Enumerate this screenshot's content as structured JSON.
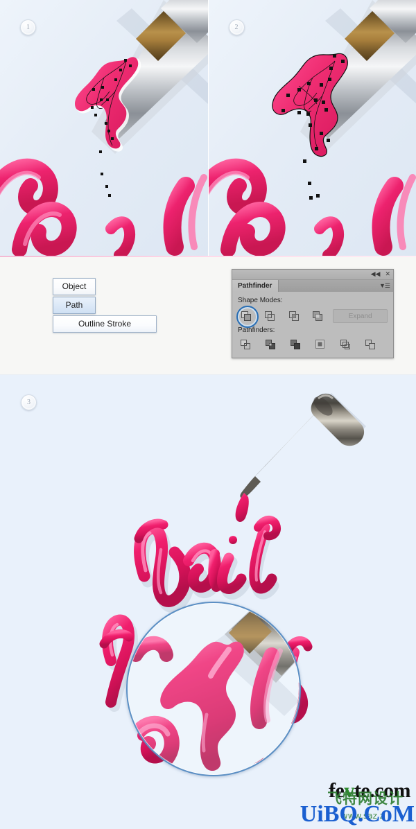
{
  "steps": [
    {
      "number": "1",
      "caption_alt": "Vector path with anchor points drawn over pink polish stroke"
    },
    {
      "number": "2",
      "caption_alt": "Stroke converted to outlined filled shape with black outline"
    },
    {
      "number": "3",
      "caption_alt": "Final Nail Polish lettering with magnifier detail"
    }
  ],
  "menu": {
    "items": [
      {
        "label": "Object",
        "state": "normal"
      },
      {
        "label": "Path",
        "state": "highlighted"
      },
      {
        "label": "Outline Stroke",
        "state": "normal"
      }
    ]
  },
  "pathfinder": {
    "titlebar": {
      "collapse_icon": "collapse-double-left-icon",
      "close_icon": "close-icon"
    },
    "tab_label": "Pathfinder",
    "panel_menu_icon": "panel-menu-icon",
    "shape_modes_label": "Shape Modes:",
    "shape_modes": [
      {
        "name": "unite",
        "selected": true
      },
      {
        "name": "minus-front",
        "selected": false
      },
      {
        "name": "intersect",
        "selected": false
      },
      {
        "name": "exclude",
        "selected": false
      }
    ],
    "expand_button": {
      "label": "Expand",
      "enabled": false
    },
    "pathfinders_label": "Pathfinders:",
    "pathfinders": [
      {
        "name": "divide"
      },
      {
        "name": "trim"
      },
      {
        "name": "merge"
      },
      {
        "name": "crop"
      },
      {
        "name": "outline"
      },
      {
        "name": "minus-back"
      }
    ]
  },
  "artwork": {
    "word_top": "Nail",
    "word_bottom": "Polish",
    "brush_cap_color": "#9fa3a8",
    "brush_ferrule_color": "#b08a46",
    "polish_color": "#ef2d72",
    "polish_highlight": "#ff9cc4",
    "canvas_color": "#e6effa",
    "magnifier_ring_color": "#5b8fc4"
  },
  "watermarks": {
    "fevte_prefix": "fe",
    "fevte_v": "v",
    "fevte_suffix": "te.com",
    "uibq": "UiBQ.CoM",
    "chinese": "飞特网设计",
    "chinese_url": "www.saz.z"
  }
}
